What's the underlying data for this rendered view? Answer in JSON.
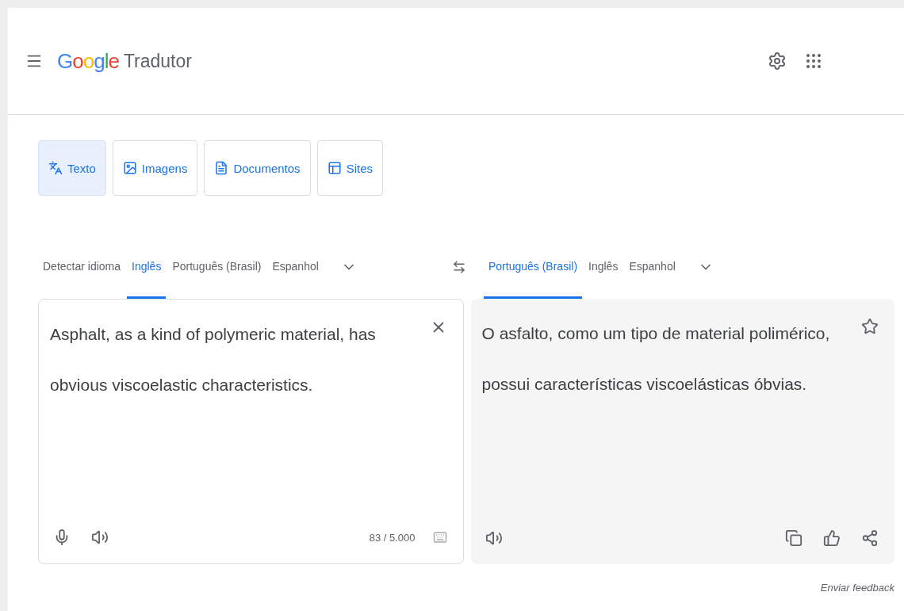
{
  "header": {
    "logo": "Google",
    "product": "Tradutor"
  },
  "modes": [
    {
      "label": "Texto",
      "kind": "text",
      "selected": true
    },
    {
      "label": "Imagens",
      "kind": "image",
      "selected": false
    },
    {
      "label": "Documentos",
      "kind": "document",
      "selected": false
    },
    {
      "label": "Sites",
      "kind": "site",
      "selected": false
    }
  ],
  "source_languages": [
    {
      "label": "Detectar idioma",
      "selected": false
    },
    {
      "label": "Inglês",
      "selected": true
    },
    {
      "label": "Português (Brasil)",
      "selected": false
    },
    {
      "label": "Espanhol",
      "selected": false
    }
  ],
  "target_languages": [
    {
      "label": "Português (Brasil)",
      "selected": true
    },
    {
      "label": "Inglês",
      "selected": false
    },
    {
      "label": "Espanhol",
      "selected": false
    }
  ],
  "source": {
    "text": "Asphalt, as a kind of polymeric material, has obvious viscoelastic characteristics.",
    "char_count": "83 / 5.000"
  },
  "target": {
    "text": "O asfalto, como um tipo de material polimérico, possui características viscoelásticas óbvias.",
    "saved": false
  },
  "feedback": "Enviar feedback"
}
